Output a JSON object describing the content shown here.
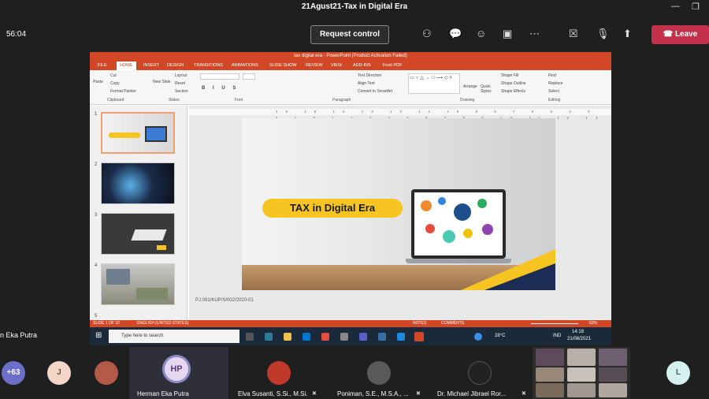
{
  "meeting": {
    "title": "21Agust21-Tax in Digital Era",
    "timer": "56:04",
    "request_control": "Request control",
    "leave": "Leave"
  },
  "ppt": {
    "title": "tax digital era - PowerPoint (Product Activation Failed)",
    "tabs": [
      "FILE",
      "HOME",
      "INSERT",
      "DESIGN",
      "TRANSITIONS",
      "ANIMATIONS",
      "SLIDE SHOW",
      "REVIEW",
      "VIEW",
      "ADD-INS",
      "Foxit PDF"
    ],
    "clipboard": {
      "paste": "Paste",
      "cut": "Cut",
      "copy": "Copy",
      "format_painter": "Format Painter",
      "group": "Clipboard"
    },
    "slides_group": {
      "new_slide": "New Slide",
      "layout": "Layout",
      "reset": "Reset",
      "section": "Section",
      "group": "Slides"
    },
    "font_group": "Font",
    "paragraph": {
      "text_direction": "Text Direction",
      "align_text": "Align Text",
      "smartart": "Convert to SmartArt",
      "group": "Paragraph"
    },
    "drawing": {
      "arrange": "Arrange",
      "quick_styles": "Quick Styles",
      "shape_fill": "Shape Fill",
      "shape_outline": "Shape Outline",
      "shape_effects": "Shape Effects",
      "group": "Drawing"
    },
    "editing": {
      "find": "Find",
      "replace": "Replace",
      "select": "Select",
      "group": "Editing"
    },
    "ruler": "16 15 14 13 12 11 10 9 8 7 6 5 4 3 2 1 0 1 2 3 4 5 6 7 8 9 10 11 12 13 14 15 16",
    "thumb_numbers": [
      "1",
      "2",
      "3",
      "4",
      "5"
    ],
    "slide_heading": "TAX in Digital Era",
    "notes": "PJ.091/KUP/S/002/2020-01",
    "status": {
      "slide": "SLIDE 1 OF 32",
      "language": "ENGLISH (UNITED STATES)",
      "notes": "NOTES",
      "comments": "COMMENTS",
      "zoom": "62%"
    },
    "taskbar": {
      "search": "Type here to search",
      "weather": "28°C",
      "lang": "IND",
      "time": "14:18",
      "date": "21/08/2021"
    }
  },
  "presenter_label": "n Eka Putra",
  "participants": {
    "overflow": "+63",
    "j": "J",
    "hp_initials": "HP",
    "hp_name": "Herman Eka Putra",
    "elva": "Elva Susanti, S.Si., M.Si.",
    "poniman": "Poniman, S.E., M.S.A., ...",
    "michael": "Dr. Michael Jibrael Ror...",
    "l": "L"
  },
  "colors": {
    "ppt_accent": "#d24726",
    "leave": "#c4314b",
    "slide_yellow": "#f7c521",
    "hp_ring": "#8b8cc7"
  }
}
